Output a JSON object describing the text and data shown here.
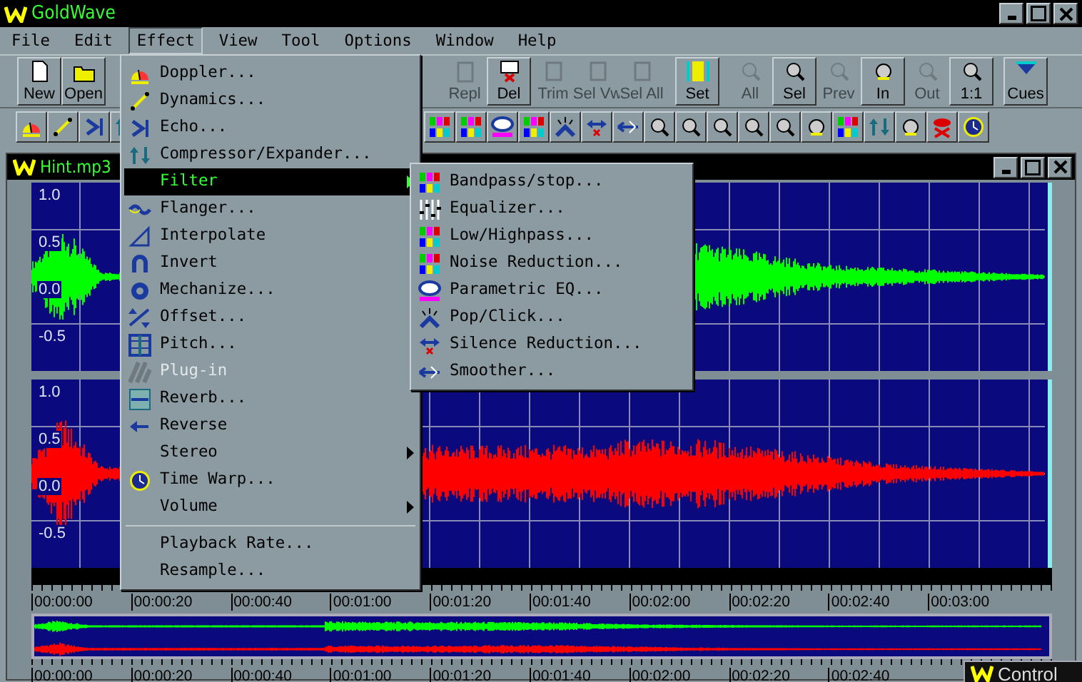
{
  "window": {
    "title": "GoldWave"
  },
  "menu_bar": [
    {
      "label": "File",
      "selected": false
    },
    {
      "label": "Edit",
      "selected": false
    },
    {
      "label": "Effect",
      "selected": true
    },
    {
      "label": "View",
      "selected": false
    },
    {
      "label": "Tool",
      "selected": false
    },
    {
      "label": "Options",
      "selected": false
    },
    {
      "label": "Window",
      "selected": false
    },
    {
      "label": "Help",
      "selected": false
    }
  ],
  "toolbar": [
    {
      "label": "New",
      "disabled": false
    },
    {
      "label": "Open",
      "disabled": false
    },
    {
      "label": "Repl",
      "disabled": true
    },
    {
      "label": "Del",
      "disabled": false
    },
    {
      "label": "Trim",
      "disabled": true
    },
    {
      "label": "Sel Vw",
      "disabled": true
    },
    {
      "label": "Sel All",
      "disabled": true
    },
    {
      "label": "Set",
      "disabled": false
    },
    {
      "label": "All",
      "disabled": true
    },
    {
      "label": "Sel",
      "disabled": false
    },
    {
      "label": "Prev",
      "disabled": true
    },
    {
      "label": "In",
      "disabled": false
    },
    {
      "label": "Out",
      "disabled": true
    },
    {
      "label": "1:1",
      "disabled": false
    },
    {
      "label": "Cues",
      "disabled": false
    }
  ],
  "sound_window": {
    "title": "Hint.mp3",
    "channels": [
      {
        "color": "#00ff00",
        "axis_labels": [
          "1.0",
          "0.5",
          "0.0",
          "-0.5"
        ]
      },
      {
        "color": "#ff0000",
        "axis_labels": [
          "1.0",
          "0.5",
          "0.0",
          "-0.5"
        ]
      }
    ],
    "time_ruler": [
      "00:00:00",
      "00:00:20",
      "00:00:40",
      "00:01:00",
      "00:01:20",
      "00:01:40",
      "00:02:00",
      "00:02:20",
      "00:02:40",
      "00:03:00"
    ],
    "overview_ruler": [
      "00:00:00",
      "00:00:20",
      "00:00:40",
      "00:01:00",
      "00:01:20",
      "00:01:40",
      "00:02:00",
      "00:02:20",
      "00:02:40"
    ]
  },
  "effect_menu": {
    "items": [
      {
        "label": "Doppler...",
        "selected": false,
        "disabled": false,
        "has_submenu": false
      },
      {
        "label": "Dynamics...",
        "selected": false,
        "disabled": false,
        "has_submenu": false
      },
      {
        "label": "Echo...",
        "selected": false,
        "disabled": false,
        "has_submenu": false
      },
      {
        "label": "Compressor/Expander...",
        "selected": false,
        "disabled": false,
        "has_submenu": false
      },
      {
        "label": "Filter",
        "selected": true,
        "disabled": false,
        "has_submenu": true
      },
      {
        "label": "Flanger...",
        "selected": false,
        "disabled": false,
        "has_submenu": false
      },
      {
        "label": "Interpolate",
        "selected": false,
        "disabled": false,
        "has_submenu": false
      },
      {
        "label": "Invert",
        "selected": false,
        "disabled": false,
        "has_submenu": false
      },
      {
        "label": "Mechanize...",
        "selected": false,
        "disabled": false,
        "has_submenu": false
      },
      {
        "label": "Offset...",
        "selected": false,
        "disabled": false,
        "has_submenu": false
      },
      {
        "label": "Pitch...",
        "selected": false,
        "disabled": false,
        "has_submenu": false
      },
      {
        "label": "Plug-in",
        "selected": false,
        "disabled": true,
        "has_submenu": false
      },
      {
        "label": "Reverb...",
        "selected": false,
        "disabled": false,
        "has_submenu": false
      },
      {
        "label": "Reverse",
        "selected": false,
        "disabled": false,
        "has_submenu": false
      },
      {
        "label": "Stereo",
        "selected": false,
        "disabled": false,
        "has_submenu": true
      },
      {
        "label": "Time Warp...",
        "selected": false,
        "disabled": false,
        "has_submenu": false
      },
      {
        "label": "Volume",
        "selected": false,
        "disabled": false,
        "has_submenu": true
      }
    ],
    "footer_items": [
      {
        "label": "Playback Rate..."
      },
      {
        "label": "Resample..."
      }
    ]
  },
  "filter_submenu": {
    "items": [
      {
        "label": "Bandpass/stop..."
      },
      {
        "label": "Equalizer..."
      },
      {
        "label": "Low/Highpass..."
      },
      {
        "label": "Noise Reduction..."
      },
      {
        "label": "Parametric EQ..."
      },
      {
        "label": "Pop/Click..."
      },
      {
        "label": "Silence Reduction..."
      },
      {
        "label": "Smoother..."
      }
    ]
  },
  "control_window": {
    "title": "Control"
  }
}
